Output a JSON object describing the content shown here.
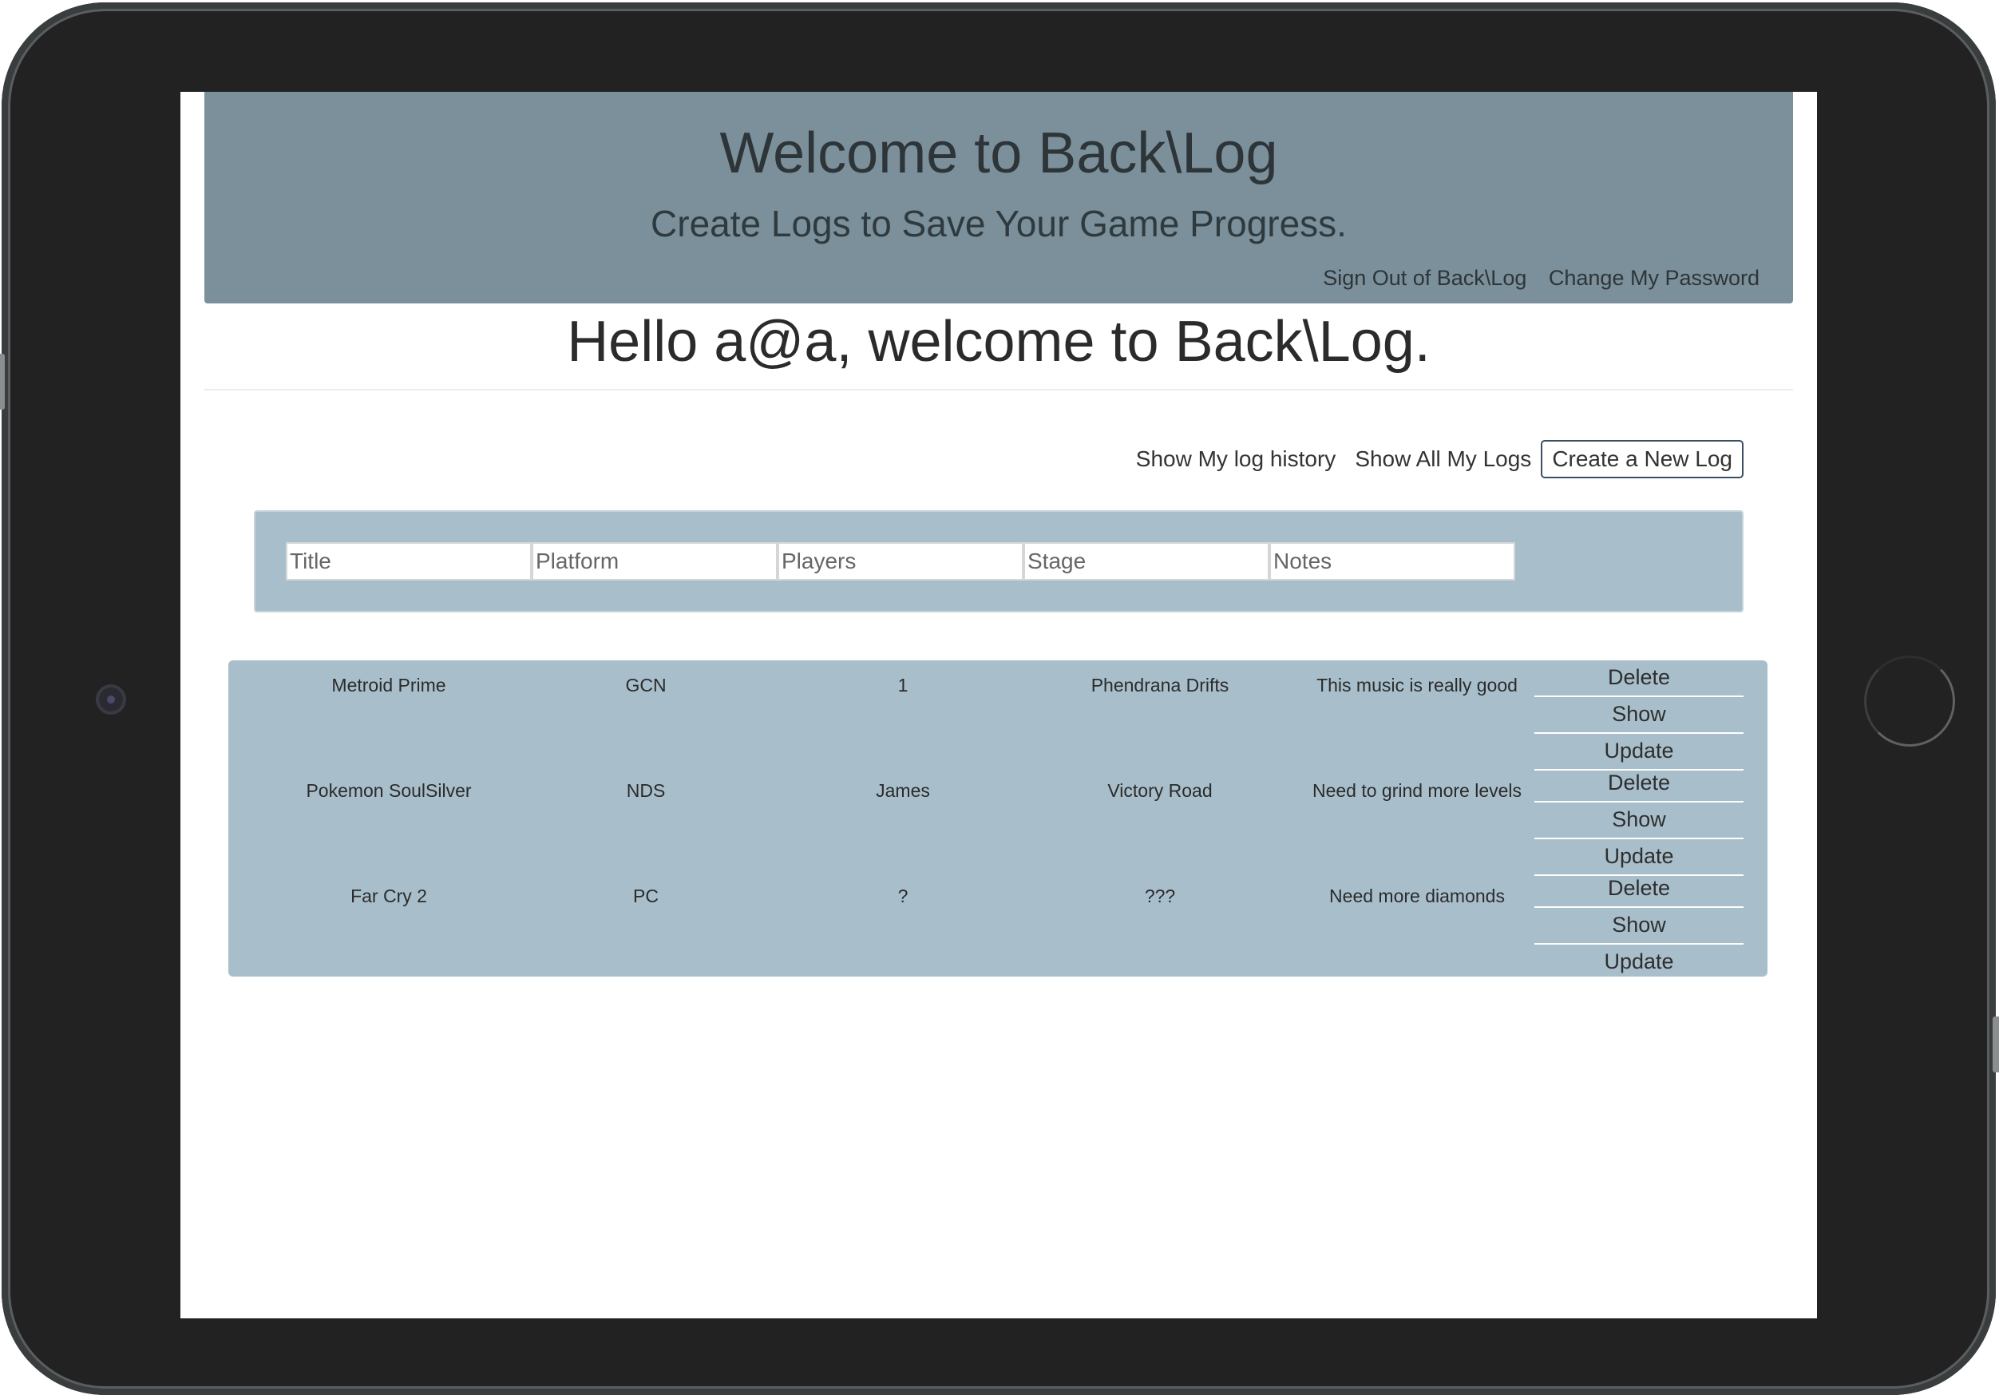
{
  "header": {
    "title": "Welcome to Back\\Log",
    "subtitle": "Create Logs to Save Your Game Progress.",
    "sign_out": "Sign Out of Back\\Log",
    "change_password": "Change My Password"
  },
  "greeting": "Hello a@a, welcome to Back\\Log.",
  "actions": {
    "history": "Show My log history",
    "all_logs": "Show All My Logs",
    "create": "Create a New Log"
  },
  "form": {
    "title_placeholder": "Title",
    "platform_placeholder": "Platform",
    "players_placeholder": "Players",
    "stage_placeholder": "Stage",
    "notes_placeholder": "Notes"
  },
  "logs": [
    {
      "title": "Metroid Prime",
      "platform": "GCN",
      "players": "1",
      "stage": "Phendrana Drifts",
      "notes": "This music is really good"
    },
    {
      "title": "Pokemon SoulSilver",
      "platform": "NDS",
      "players": "James",
      "stage": "Victory Road",
      "notes": "Need to grind more levels"
    },
    {
      "title": "Far Cry 2",
      "platform": "PC",
      "players": "?",
      "stage": "???",
      "notes": "Need more diamonds"
    }
  ],
  "row_buttons": {
    "delete": "Delete",
    "show": "Show",
    "update": "Update"
  }
}
